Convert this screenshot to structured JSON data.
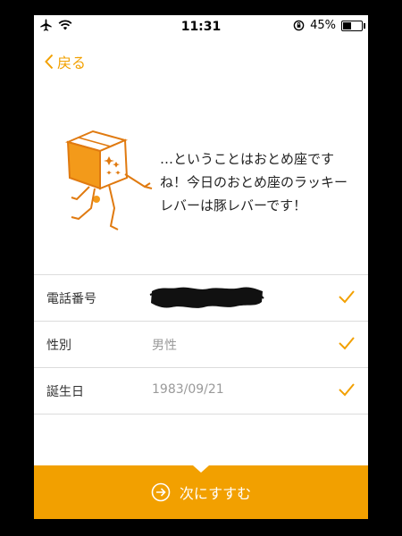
{
  "status": {
    "time": "11:31",
    "battery": "45%",
    "battery_level": 0.45
  },
  "nav": {
    "back_label": "戻る"
  },
  "message": "…ということはおとめ座ですね！今日のおとめ座のラッキーレバーは豚レバーです！",
  "form": {
    "rows": [
      {
        "label": "電話番号",
        "value": ""
      },
      {
        "label": "性別",
        "value": "男性"
      },
      {
        "label": "誕生日",
        "value": "1983/09/21"
      }
    ]
  },
  "next_button": {
    "label": "次にすすむ"
  },
  "colors": {
    "accent": "#f2a000"
  }
}
